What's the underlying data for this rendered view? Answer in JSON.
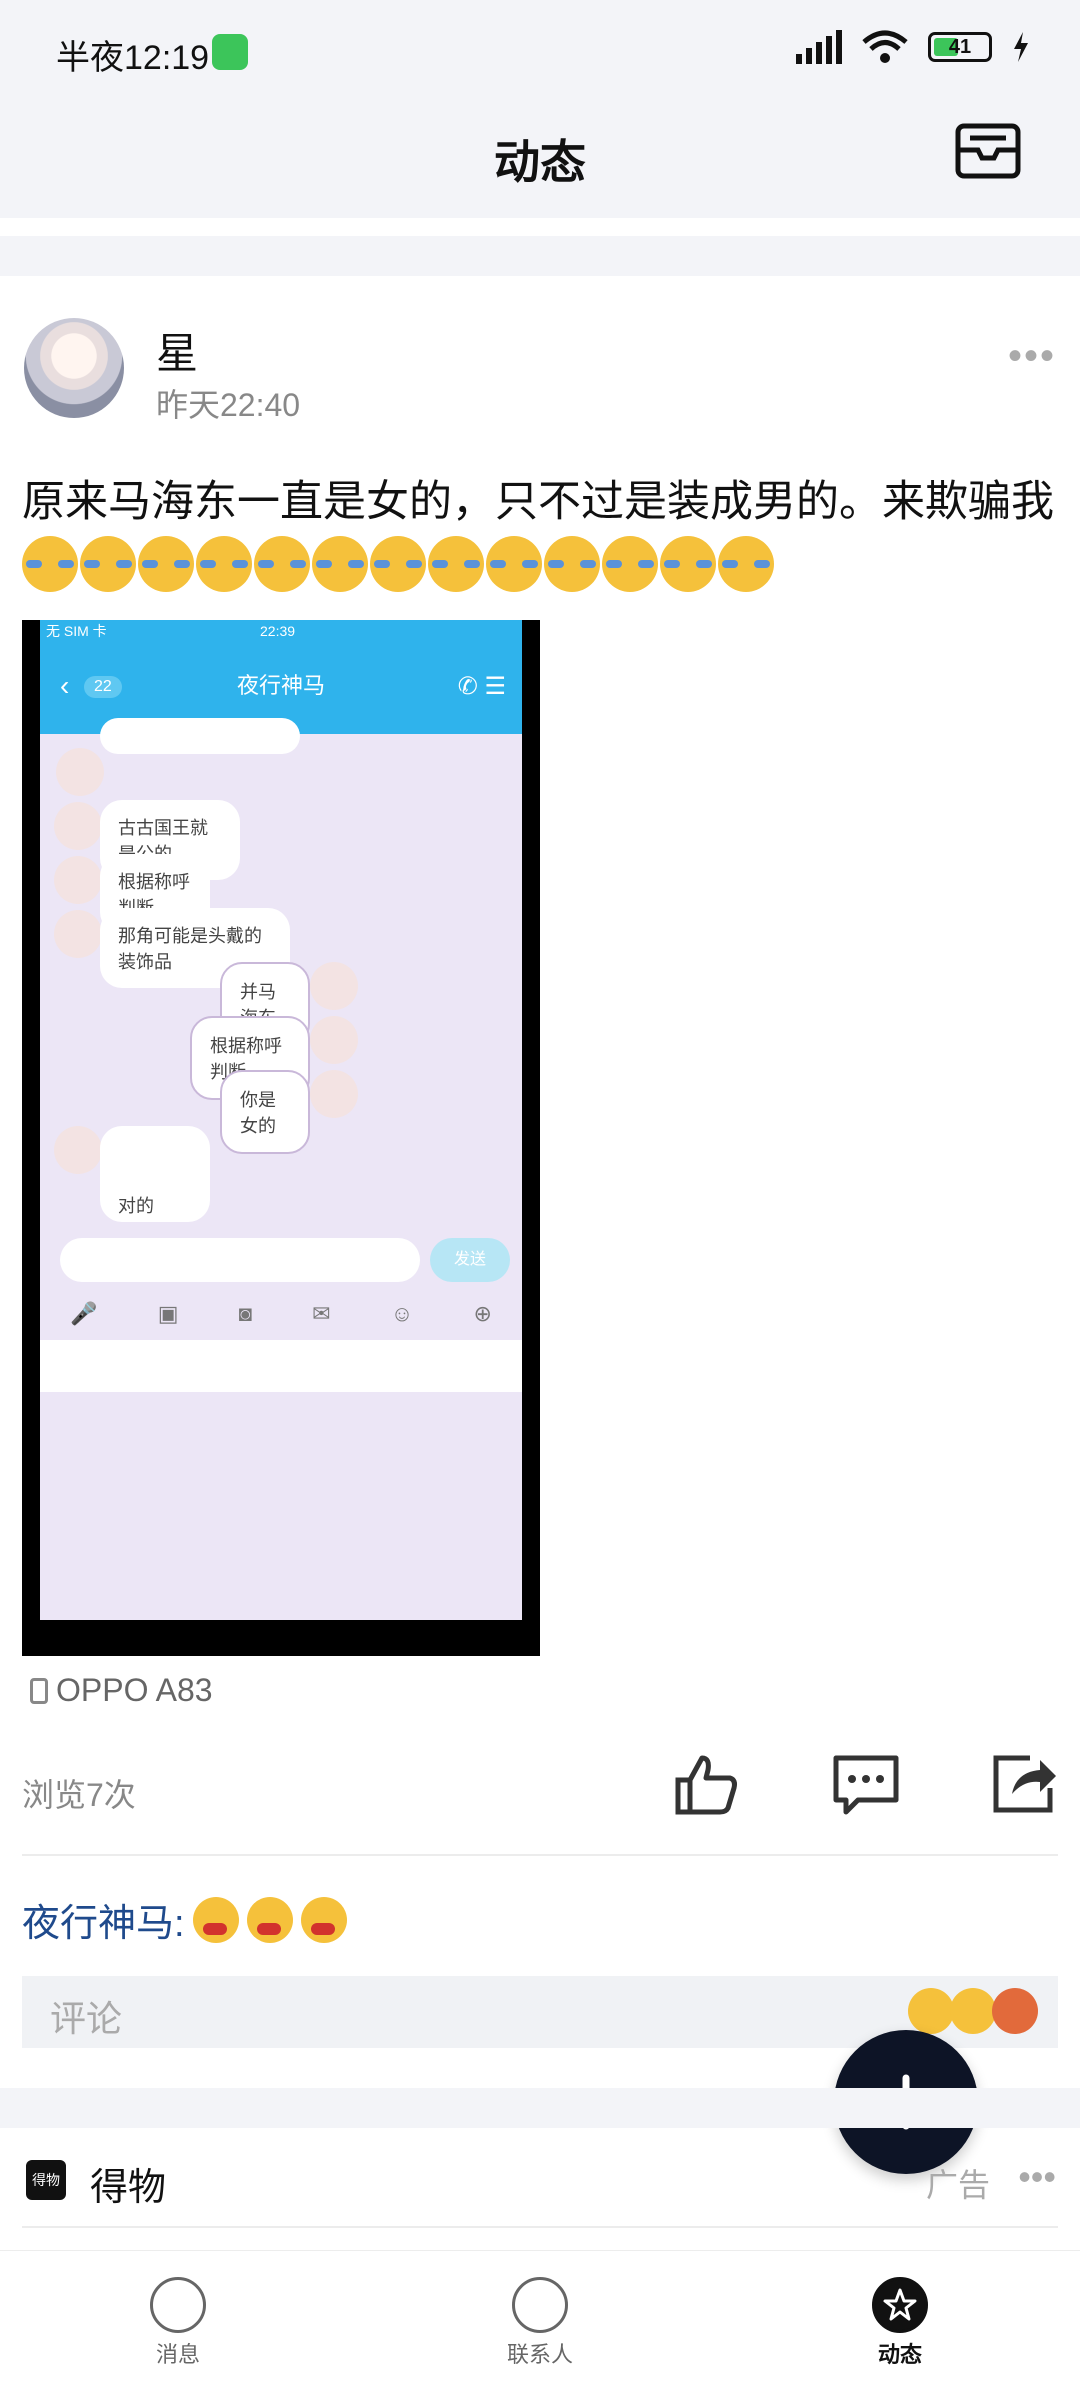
{
  "status_bar": {
    "time": "半夜12:19",
    "battery": "41"
  },
  "header": {
    "title": "动态"
  },
  "post": {
    "author": "星",
    "time": "昨天22:40",
    "text": "原来马海东一直是女的，只不过是装成男的。来欺骗我",
    "emoji_count": 13,
    "device": "OPPO A83",
    "views": "浏览7次"
  },
  "screenshot": {
    "status_left": "无 SIM 卡",
    "time": "22:39",
    "title": "夜行神马",
    "badge": "22",
    "messages": [
      {
        "side": "other",
        "text": "古古国王就是公的"
      },
      {
        "side": "other",
        "text": "根据称呼判断"
      },
      {
        "side": "other",
        "text": "那角可能是头戴的装饰品"
      },
      {
        "side": "me",
        "text": "并马海东"
      },
      {
        "side": "me",
        "text": "根据称呼判断"
      },
      {
        "side": "me",
        "text": "你是女的"
      },
      {
        "side": "other",
        "text": "对的"
      }
    ],
    "send_label": "发送"
  },
  "comment": {
    "author": "夜行神马:",
    "placeholder": "评论"
  },
  "ad": {
    "name": "得物",
    "tag": "广告",
    "logo_text": "得物"
  },
  "tabs": [
    {
      "label": "消息",
      "active": false
    },
    {
      "label": "联系人",
      "active": false
    },
    {
      "label": "动态",
      "active": true
    }
  ],
  "colors": {
    "accent": "#0d1426",
    "comment_author": "#1f4a8c",
    "screenshot_bar": "#2fb3ec"
  }
}
